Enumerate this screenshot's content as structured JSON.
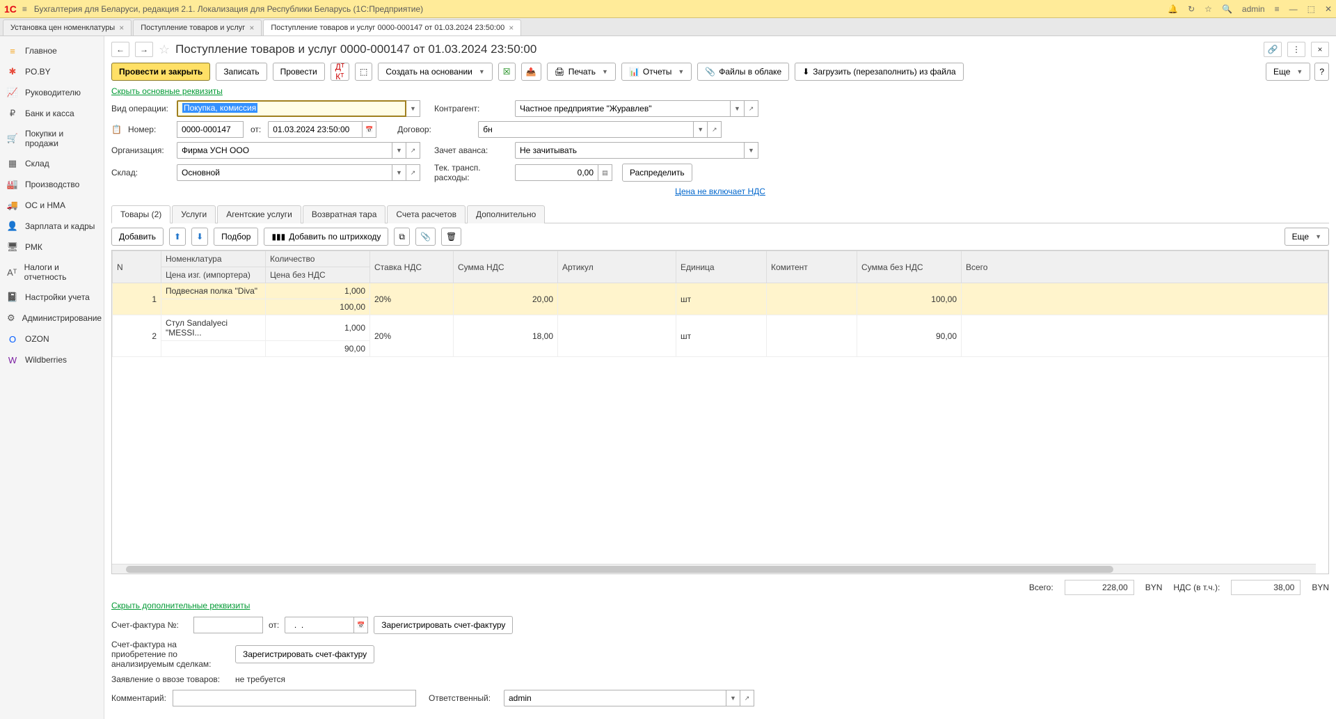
{
  "titlebar": {
    "app_title": "Бухгалтерия для Беларуси, редакция 2.1. Локализация для Республики Беларусь   (1С:Предприятие)",
    "user": "admin"
  },
  "tabs": [
    {
      "label": "Установка цен номенклатуры",
      "active": false
    },
    {
      "label": "Поступление товаров и услуг",
      "active": false
    },
    {
      "label": "Поступление товаров и услуг 0000-000147 от 01.03.2024 23:50:00",
      "active": true
    }
  ],
  "sidebar": {
    "items": [
      {
        "label": "Главное",
        "icon": "≡",
        "color": "#f5a623"
      },
      {
        "label": "PO.BY",
        "icon": "✱",
        "color": "#e74c3c"
      },
      {
        "label": "Руководителю",
        "icon": "📈",
        "color": "#555"
      },
      {
        "label": "Банк и касса",
        "icon": "₽",
        "color": "#555"
      },
      {
        "label": "Покупки и продажи",
        "icon": "🛒",
        "color": "#555"
      },
      {
        "label": "Склад",
        "icon": "▦",
        "color": "#555"
      },
      {
        "label": "Производство",
        "icon": "🏭",
        "color": "#555"
      },
      {
        "label": "ОС и НМА",
        "icon": "🚚",
        "color": "#555"
      },
      {
        "label": "Зарплата и кадры",
        "icon": "👤",
        "color": "#555"
      },
      {
        "label": "РМК",
        "icon": "🖥",
        "color": "#555"
      },
      {
        "label": "Налоги и отчетность",
        "icon": "Aᵀ",
        "color": "#555"
      },
      {
        "label": "Настройки учета",
        "icon": "📓",
        "color": "#555"
      },
      {
        "label": "Администрирование",
        "icon": "⚙",
        "color": "#555"
      },
      {
        "label": "OZON",
        "icon": "O",
        "color": "#005bff"
      },
      {
        "label": "Wildberries",
        "icon": "W",
        "color": "#7b1fa2"
      }
    ]
  },
  "doc": {
    "title": "Поступление товаров и услуг 0000-000147 от 01.03.2024 23:50:00",
    "hide_link": "Скрыть основные реквизиты",
    "hide_link2": "Скрыть дополнительные реквизиты",
    "vat_link": "Цена не включает НДС"
  },
  "toolbar": {
    "post_close": "Провести и закрыть",
    "save": "Записать",
    "post": "Провести",
    "create_based": "Создать на основании",
    "print": "Печать",
    "reports": "Отчеты",
    "files": "Файлы в облаке",
    "load": "Загрузить (перезаполнить) из файла",
    "more": "Еще"
  },
  "form": {
    "op_type_label": "Вид операции:",
    "op_type_value": "Покупка, комиссия",
    "number_label": "Номер:",
    "number_value": "0000-000147",
    "from_label": "от:",
    "date_value": "01.03.2024 23:50:00",
    "org_label": "Организация:",
    "org_value": "Фирма УСН ООО",
    "warehouse_label": "Склад:",
    "warehouse_value": "Основной",
    "contractor_label": "Контрагент:",
    "contractor_value": "Частное предприятие \"Журавлев\"",
    "contract_label": "Договор:",
    "contract_value": "бн",
    "advance_label": "Зачет аванса:",
    "advance_value": "Не зачитывать",
    "transport_label": "Тек. трансп. расходы:",
    "transport_value": "0,00",
    "distribute": "Распределить"
  },
  "doc_tabs": [
    {
      "label": "Товары (2)",
      "active": true
    },
    {
      "label": "Услуги",
      "active": false
    },
    {
      "label": "Агентские услуги",
      "active": false
    },
    {
      "label": "Возвратная тара",
      "active": false
    },
    {
      "label": "Счета расчетов",
      "active": false
    },
    {
      "label": "Дополнительно",
      "active": false
    }
  ],
  "table_toolbar": {
    "add": "Добавить",
    "pick": "Подбор",
    "barcode": "Добавить по штрихкоду",
    "more": "Еще"
  },
  "table": {
    "headers": {
      "n": "N",
      "nomenclature": "Номенклатура",
      "qty": "Количество",
      "vat_rate": "Ставка НДС",
      "vat_sum": "Сумма НДС",
      "article": "Артикул",
      "unit": "Единица",
      "committent": "Комитент",
      "sum_no_vat": "Сумма без НДС",
      "total": "Всего",
      "importer_price": "Цена изг. (импортера)",
      "price_no_vat": "Цена без НДС"
    },
    "rows": [
      {
        "n": "1",
        "name": "Подвесная полка \"Diva\"",
        "qty": "1,000",
        "price_no_vat": "100,00",
        "vat_rate": "20%",
        "vat_sum": "20,00",
        "unit": "шт",
        "sum_no_vat": "100,00",
        "selected": true
      },
      {
        "n": "2",
        "name": "Стул Sandalyeci \"MESSI...",
        "qty": "1,000",
        "price_no_vat": "90,00",
        "vat_rate": "20%",
        "vat_sum": "18,00",
        "unit": "шт",
        "sum_no_vat": "90,00",
        "selected": false
      }
    ]
  },
  "totals": {
    "total_label": "Всего:",
    "total_value": "228,00",
    "currency": "BYN",
    "vat_label": "НДС (в т.ч.):",
    "vat_value": "38,00"
  },
  "footer": {
    "invoice_num_label": "Счет-фактура №:",
    "from_label": "от:",
    "date_placeholder": "  .  .",
    "register_invoice": "Зарегистрировать счет-фактуру",
    "invoice_acq_label": "Счет-фактура на приобретение по анализируемым сделкам:",
    "import_decl_label": "Заявление о ввозе товаров:",
    "import_decl_value": "не требуется",
    "comment_label": "Комментарий:",
    "responsible_label": "Ответственный:",
    "responsible_value": "admin"
  }
}
